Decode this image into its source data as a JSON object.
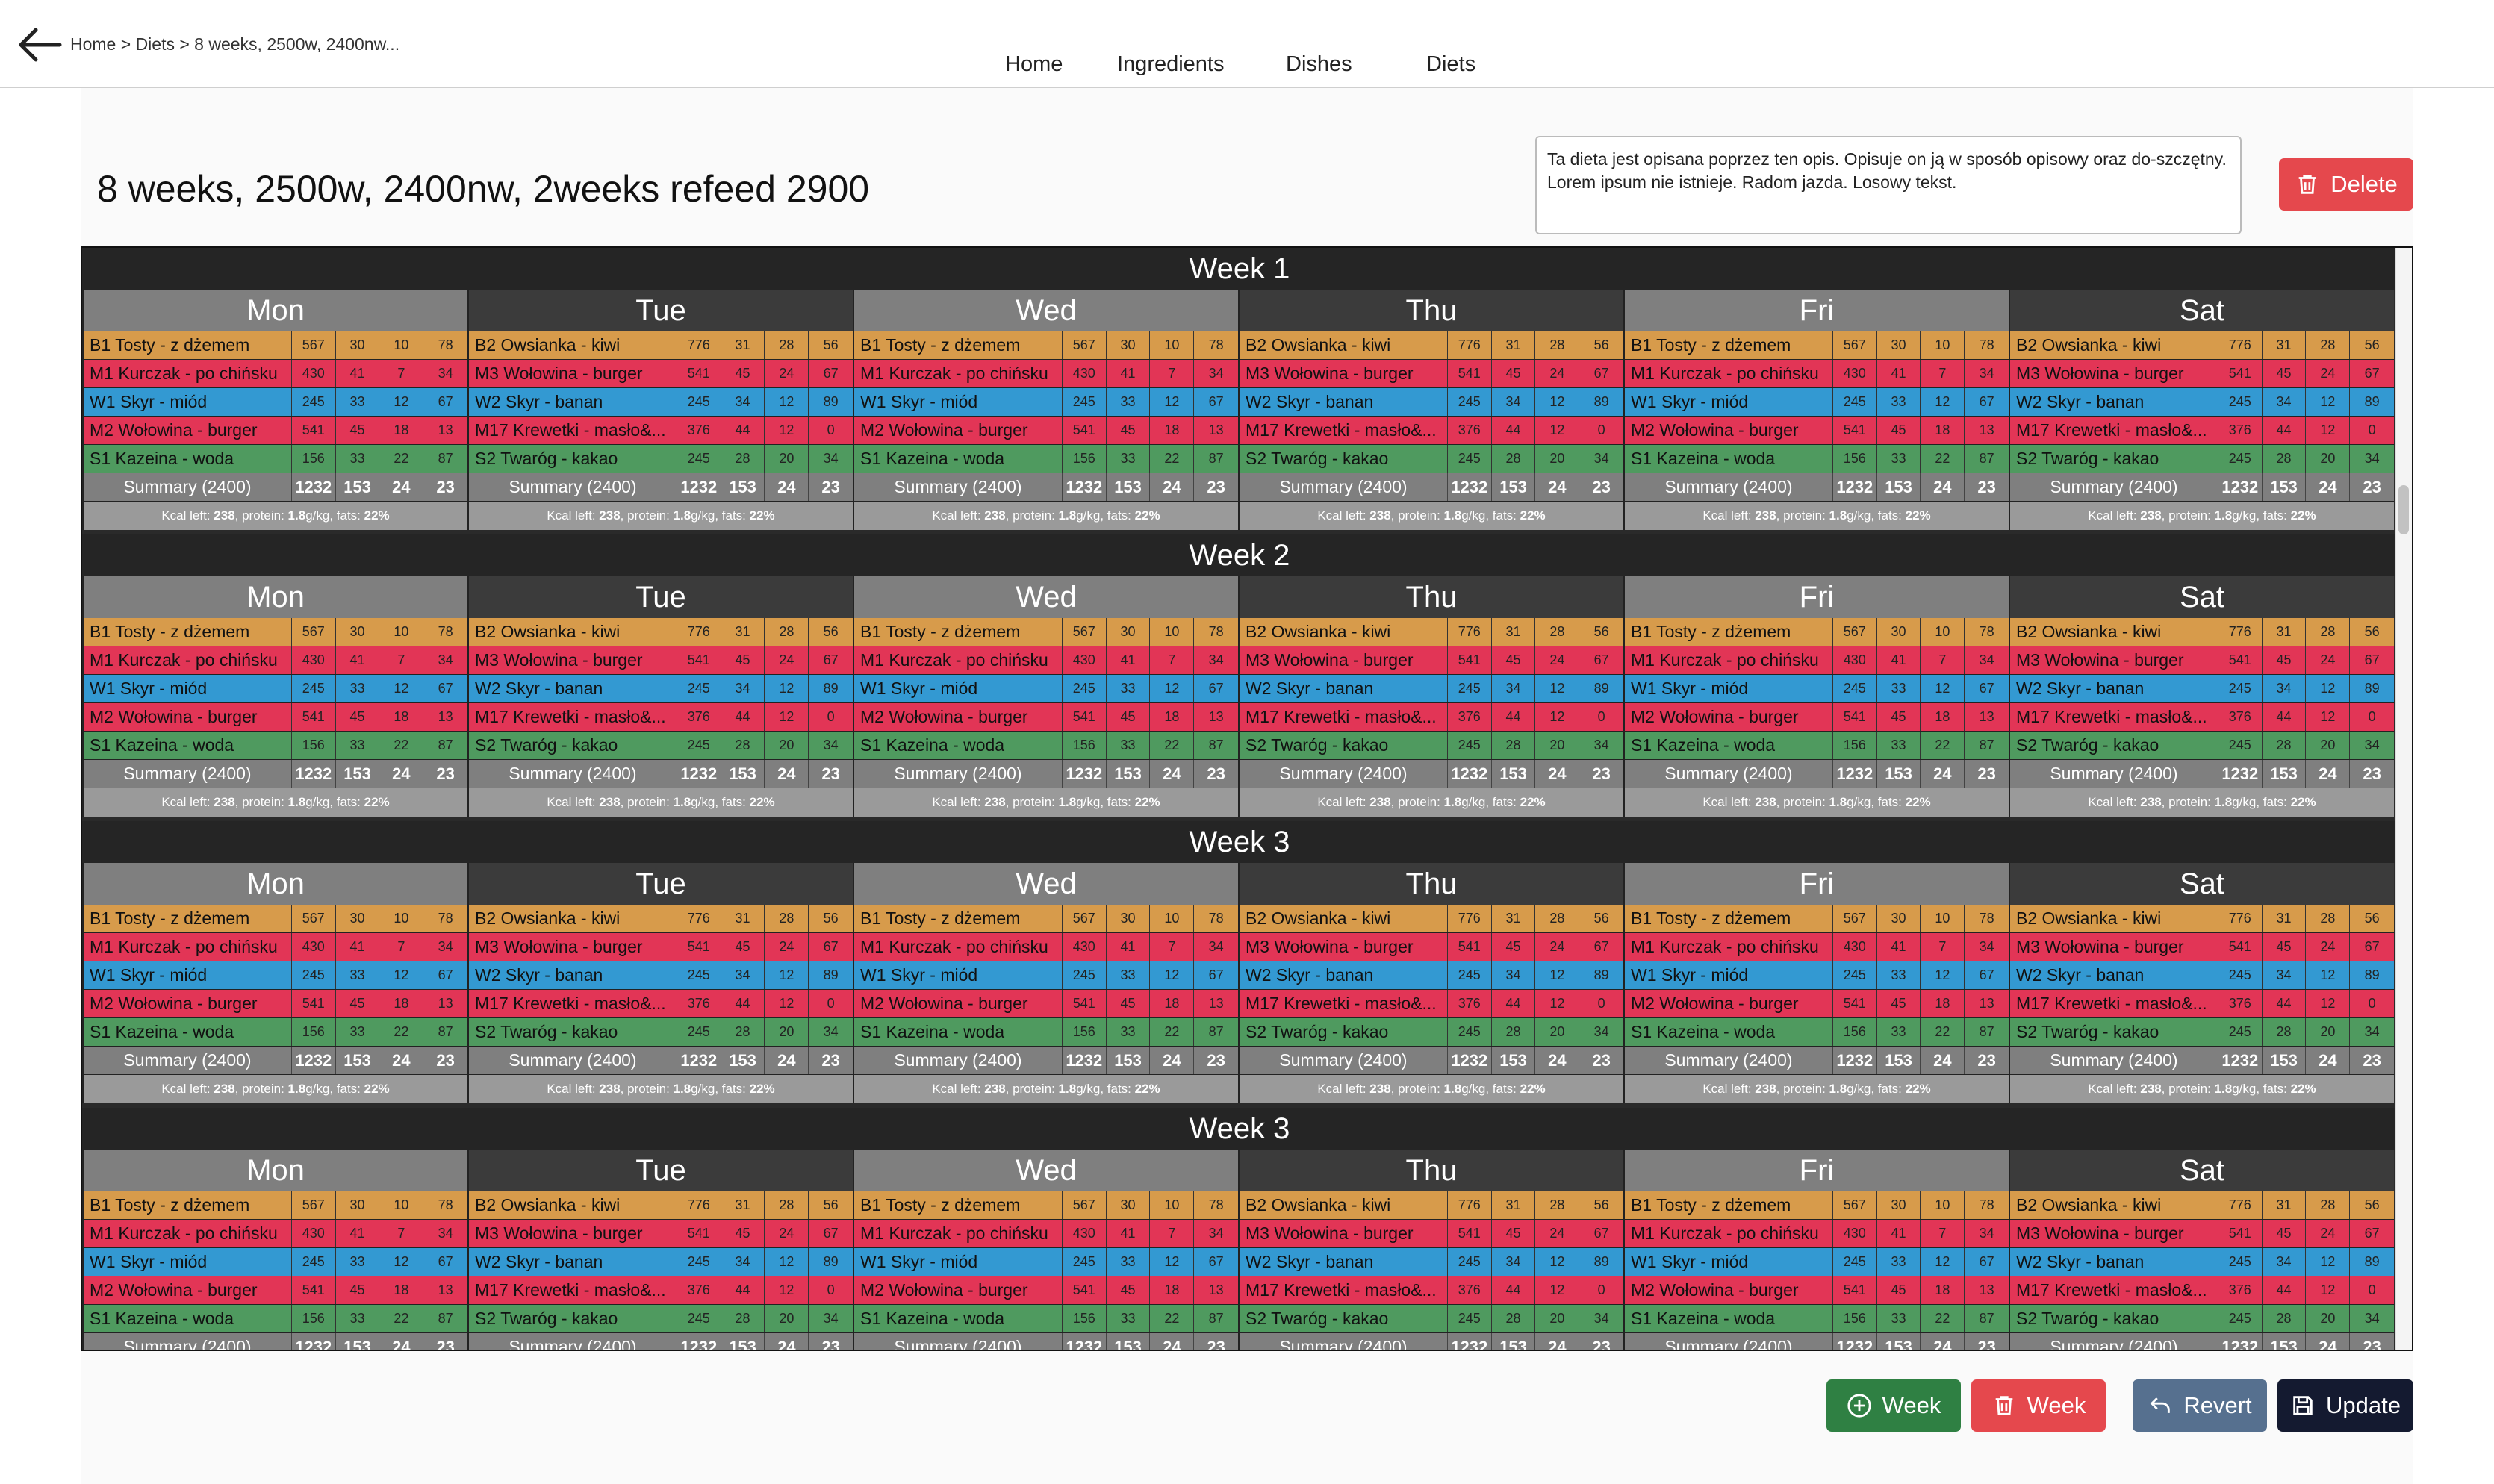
{
  "breadcrumb": "Home > Diets > 8 weeks, 2500w, 2400nw...",
  "nav": [
    "Home",
    "Ingredients",
    "Dishes",
    "Diets"
  ],
  "title": "8 weeks, 2500w, 2400nw, 2weeks refeed 2900",
  "description": "Ta dieta jest opisana poprzez ten opis. Opisuje on ją w sposób opisowy oraz do-szczętny. Lorem ipsum nie istnieje. Radom jazda. Losowy tekst.",
  "buttons": {
    "delete": "Delete",
    "add_week": "Week",
    "remove_week": "Week",
    "revert": "Revert",
    "update": "Update"
  },
  "colors": {
    "breakfast": "#d79b4b",
    "meal": "#e23556",
    "second": "#3399d2",
    "dinner": "#e23556",
    "supper": "#4f9a5f",
    "day_light": "#7f7f7f",
    "day_dark": "#3b3b3b",
    "delete_red": "#e5484d",
    "add_green": "#2f8043",
    "revert_blue": "#56708f",
    "update_dark": "#141a30"
  },
  "meal_colors_a": [
    "#d79b4b",
    "#e23556",
    "#3399d2",
    "#e23556",
    "#4f9a5f"
  ],
  "weeks": [
    "Week 1",
    "Week 2",
    "Week 3",
    "Week 3"
  ],
  "days": [
    "Mon",
    "Tue",
    "Wed",
    "Thu",
    "Fri",
    "Sat"
  ],
  "meals_a": [
    {
      "name": "B1 Tosty -  z dżemem",
      "vals": [
        "567",
        "30",
        "10",
        "78"
      ]
    },
    {
      "name": "M1 Kurczak - po chińsku",
      "vals": [
        "430",
        "41",
        "7",
        "34"
      ]
    },
    {
      "name": "W1 Skyr - miód",
      "vals": [
        "245",
        "33",
        "12",
        "67"
      ]
    },
    {
      "name": "M2 Wołowina - burger",
      "vals": [
        "541",
        "45",
        "18",
        "13"
      ]
    },
    {
      "name": "S1 Kazeina - woda",
      "vals": [
        "156",
        "33",
        "22",
        "87"
      ]
    }
  ],
  "meals_b": [
    {
      "name": "B2 Owsianka - kiwi",
      "vals": [
        "776",
        "31",
        "28",
        "56"
      ]
    },
    {
      "name": "M3 Wołowina - burger",
      "vals": [
        "541",
        "45",
        "24",
        "67"
      ]
    },
    {
      "name": "W2 Skyr - banan",
      "vals": [
        "245",
        "34",
        "12",
        "89"
      ]
    },
    {
      "name": "M17 Krewetki - masło&...",
      "vals": [
        "376",
        "44",
        "12",
        "0"
      ]
    },
    {
      "name": "S2 Twaróg - kakao",
      "vals": [
        "245",
        "28",
        "20",
        "34"
      ]
    }
  ],
  "summary": {
    "label": "Summary (2400)",
    "vals": [
      "1232",
      "153",
      "24",
      "23"
    ]
  },
  "kcal": {
    "kcal_label": "Kcal left:",
    "kcal": "238",
    "protein_label": ", protein:",
    "protein": "1.8",
    "protein_unit": "g/kg, fats:",
    "fats": "22%"
  }
}
